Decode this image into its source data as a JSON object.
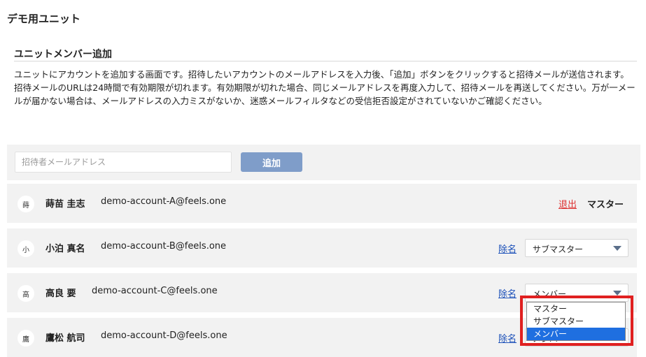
{
  "unit_title": "デモ用ユニット",
  "section": {
    "title": "ユニットメンバー追加",
    "description_1": "ユニットにアカウントを追加する画面です。招待したいアカウントのメールアドレスを入力後、「追加」ボタンをクリックすると招待メールが送信されます。",
    "description_2": "招待メールのURLは24時間で有効期限が切れます。有効期限が切れた場合、同じメールアドレスを再度入力して、招待メールを再送してください。万が一メールが届かない場合は、メールアドレスの入力ミスがないか、迷惑メールフィルタなどの受信拒否設定がされていないかご確認ください。"
  },
  "add_form": {
    "email_placeholder": "招待者メールアドレス",
    "email_value": "",
    "add_label": "追加"
  },
  "members": [
    {
      "initial": "蒔",
      "name": "蒔苗 圭志",
      "email": "demo-account-A@feels.one",
      "action": "退出",
      "role": "マスター"
    },
    {
      "initial": "小",
      "name": "小泊 真名",
      "email": "demo-account-B@feels.one",
      "action": "除名",
      "role": "サブマスター"
    },
    {
      "initial": "高",
      "name": "高良 要",
      "email": "demo-account-C@feels.one",
      "action": "除名",
      "role": "メンバー"
    },
    {
      "initial": "鷹",
      "name": "鷹松 航司",
      "email": "demo-account-D@feels.one",
      "action": "除名",
      "role": "メンバー"
    }
  ],
  "role_dropdown": {
    "options": [
      "マスター",
      "サブマスター",
      "メンバー"
    ],
    "selected": "メンバー"
  },
  "colors": {
    "add_button": "#7f9dc9",
    "leave_link": "#dd3333",
    "remove_link": "#1a4fb8",
    "dropdown_selected": "#1f6fe0",
    "highlight": "#e02020"
  }
}
